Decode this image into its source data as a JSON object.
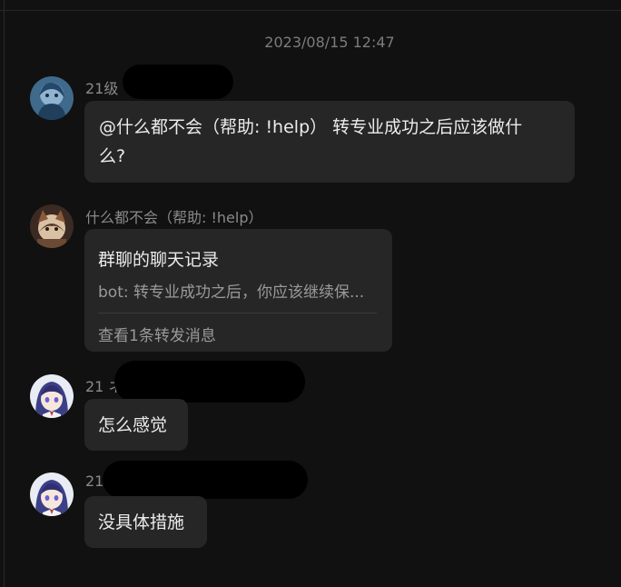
{
  "chat": {
    "timestamp": "2023/08/15 12:47",
    "messages": [
      {
        "sender": "21级",
        "text": "@什么都不会（帮助: !help） 转专业成功之后应该做什么?",
        "text_line1": "@什么都不会（帮助: !help） 转专业成功之后应该做什",
        "text_line2": "么?"
      },
      {
        "sender": "什么都不会（帮助: !help）",
        "forward": {
          "title": "群聊的聊天记录",
          "preview": "bot: 转专业成功之后，你应该继续保...",
          "footer": "查看1条转发消息"
        }
      },
      {
        "sender": "21 ネ",
        "text": "怎么感觉"
      },
      {
        "sender": "21",
        "text": "没具体措施"
      }
    ]
  },
  "colors": {
    "background": "#111111",
    "bubble": "#262626",
    "sender_text": "#8a8a8a",
    "message_text": "#ececec",
    "redaction": "#000000"
  }
}
